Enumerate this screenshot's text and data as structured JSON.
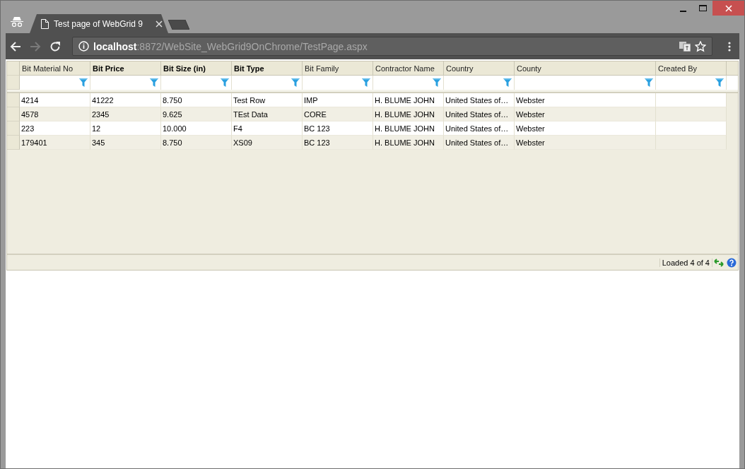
{
  "browser": {
    "tabs": [
      {
        "title": "Test page of WebGrid 9",
        "selected": true
      }
    ],
    "back_disabled": false,
    "forward_disabled": true,
    "address": "**localhost**:8872/WebSite_WebGrid9OnChrome/TestPage.aspx"
  },
  "grid": {
    "columns": [
      {
        "label": "Bit Material No",
        "bold": false
      },
      {
        "label": "Bit Price",
        "bold": true
      },
      {
        "label": "Bit Size (in)",
        "bold": true
      },
      {
        "label": "Bit Type",
        "bold": true
      },
      {
        "label": "Bit Family",
        "bold": false
      },
      {
        "label": "Contractor Name",
        "bold": false
      },
      {
        "label": "Country",
        "bold": false
      },
      {
        "label": "County",
        "bold": false
      },
      {
        "label": "Created By",
        "bold": false
      }
    ],
    "rows": [
      {
        "cells": [
          "4214",
          "41222",
          "8.750",
          "Test Row",
          "IMP",
          "H. BLUME JOHN",
          "United States of…",
          "Webster"
        ]
      },
      {
        "cells": [
          "4578",
          "2345",
          "9.625",
          "TEst Data",
          "CORE",
          "H. BLUME JOHN",
          "United States of…",
          "Webster"
        ]
      },
      {
        "cells": [
          "223",
          "12",
          "10.000",
          "F4",
          "BC 123",
          "H. BLUME JOHN",
          "United States of…",
          "Webster"
        ]
      },
      {
        "cells": [
          "179401",
          "345",
          "8.750",
          "XS09",
          "BC 123",
          "H. BLUME JOHN",
          "United States of…",
          "Webster"
        ]
      }
    ],
    "status": "Loaded 4 of 4"
  }
}
